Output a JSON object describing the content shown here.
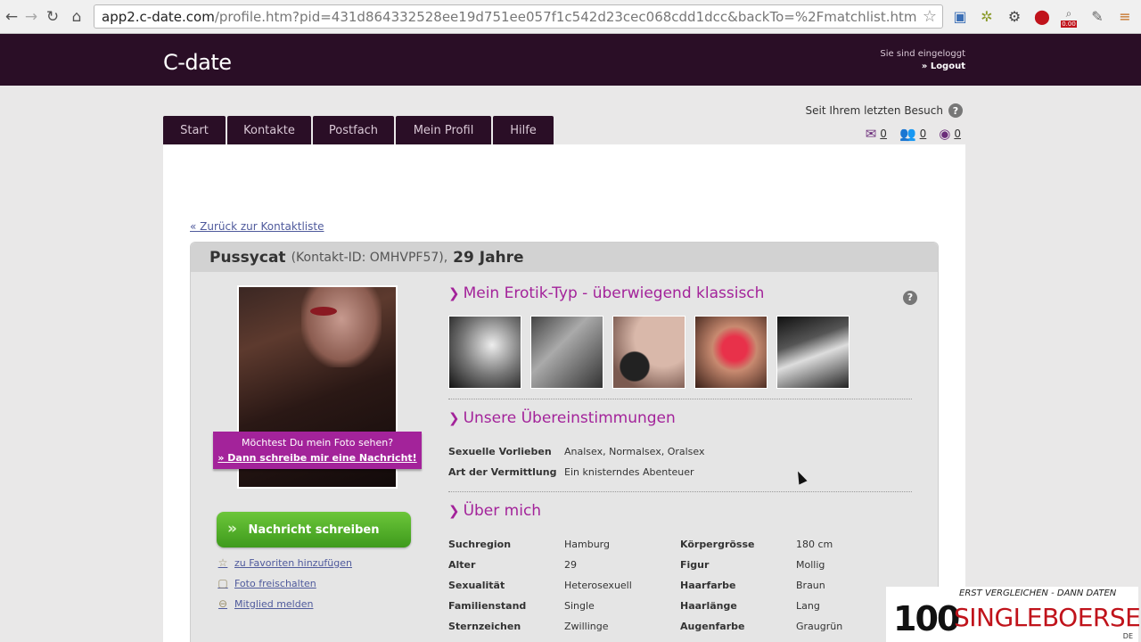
{
  "browser": {
    "url_host": "app2.c-date.com",
    "url_rest": "/profile.htm?pid=431d864332528ee19d751ee057f1c542d23cec068cdd1dcc&backTo=%2Fmatchlist.htm",
    "ext_badge": "0.00"
  },
  "header": {
    "logo": "C-date",
    "logged_in": "Sie sind eingeloggt",
    "logout": "» Logout"
  },
  "tabs": [
    {
      "label": "Start"
    },
    {
      "label": "Kontakte"
    },
    {
      "label": "Postfach"
    },
    {
      "label": "Mein Profil"
    },
    {
      "label": "Hilfe"
    }
  ],
  "visit": {
    "label": "Seit Ihrem letzten Besuch",
    "messages": "0",
    "contacts": "0",
    "views": "0"
  },
  "back_link": "« Zurück zur Kontaktliste",
  "profile": {
    "name": "Pussycat",
    "contact_id": "(Kontakt-ID: OMHVPF57),",
    "age": "29 Jahre",
    "photo_banner_1": "Möchtest Du mein Foto sehen?",
    "photo_banner_2": "» Dann schreibe mir eine Nachricht!",
    "message_button": "Nachricht schreiben",
    "fav_link": "zu Favoriten hinzufügen",
    "photo_link": "Foto freischalten",
    "report_link": "Mitglied melden"
  },
  "sections": {
    "erotik_title": "Mein Erotik-Typ - überwiegend klassisch",
    "match_title": "Unsere Übereinstimmungen",
    "about_title": "Über mich"
  },
  "matches": [
    {
      "key": "Sexuelle Vorlieben",
      "value": "Analsex, Normalsex, Oralsex"
    },
    {
      "key": "Art der Vermittlung",
      "value": "Ein knisterndes Abenteuer"
    }
  ],
  "about": [
    {
      "key": "Suchregion",
      "value": "Hamburg",
      "key2": "Körpergrösse",
      "value2": "180 cm"
    },
    {
      "key": "Alter",
      "value": "29",
      "key2": "Figur",
      "value2": "Mollig"
    },
    {
      "key": "Sexualität",
      "value": "Heterosexuell",
      "key2": "Haarfarbe",
      "value2": "Braun"
    },
    {
      "key": "Familienstand",
      "value": "Single",
      "key2": "Haarlänge",
      "value2": "Lang"
    },
    {
      "key": "Sternzeichen",
      "value": "Zwillinge",
      "key2": "Augenfarbe",
      "value2": "Graugrün"
    }
  ],
  "watermark": {
    "tagline": "ERST VERGLEICHEN - DANN DATEN",
    "number": "100",
    "brand": "SINGLEBOERSEN",
    "tld": "DE"
  }
}
